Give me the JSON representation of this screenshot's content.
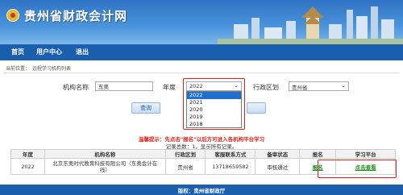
{
  "header": {
    "site_title": "贵州省财政会计网"
  },
  "nav": {
    "items": [
      "首页",
      "用户中心",
      "退出"
    ]
  },
  "breadcrumb": {
    "prefix": "当前位置：",
    "page": "远程学习机构列表"
  },
  "form": {
    "org_label": "机构名称",
    "org_value": "东奥",
    "year_label": "年度",
    "year_value": "2022",
    "year_options": [
      "2022",
      "2021",
      "2020",
      "2019",
      "2018"
    ],
    "region_label": "行政区划",
    "region_value": "贵州省",
    "query_button": "查询"
  },
  "notice": {
    "tip": "温馨提示：先点击\"报名\"以后方可进入各机构平台学习",
    "count": "记录总数：1，显示所有记录。"
  },
  "table": {
    "headers": [
      "年度",
      "机构名称",
      "行政区划",
      "客服联系方式",
      "备审状态",
      "报名",
      "学习平台"
    ],
    "rows": [
      {
        "year": "2022",
        "org_line1": "北京东奥时代教育科技有限公司（东奥会计在",
        "org_line2": "线）",
        "region": "贵州省",
        "phone": "13718659582",
        "status": "审核通过",
        "register": "报名",
        "platform": "点击查看"
      }
    ]
  },
  "footer": {
    "copyright": "版权：贵州省财政厅"
  },
  "colors": {
    "nav": "#1a5fae",
    "highlight": "#e0201b",
    "link": "#1f8a1f",
    "selected": "#1e6fd0"
  }
}
